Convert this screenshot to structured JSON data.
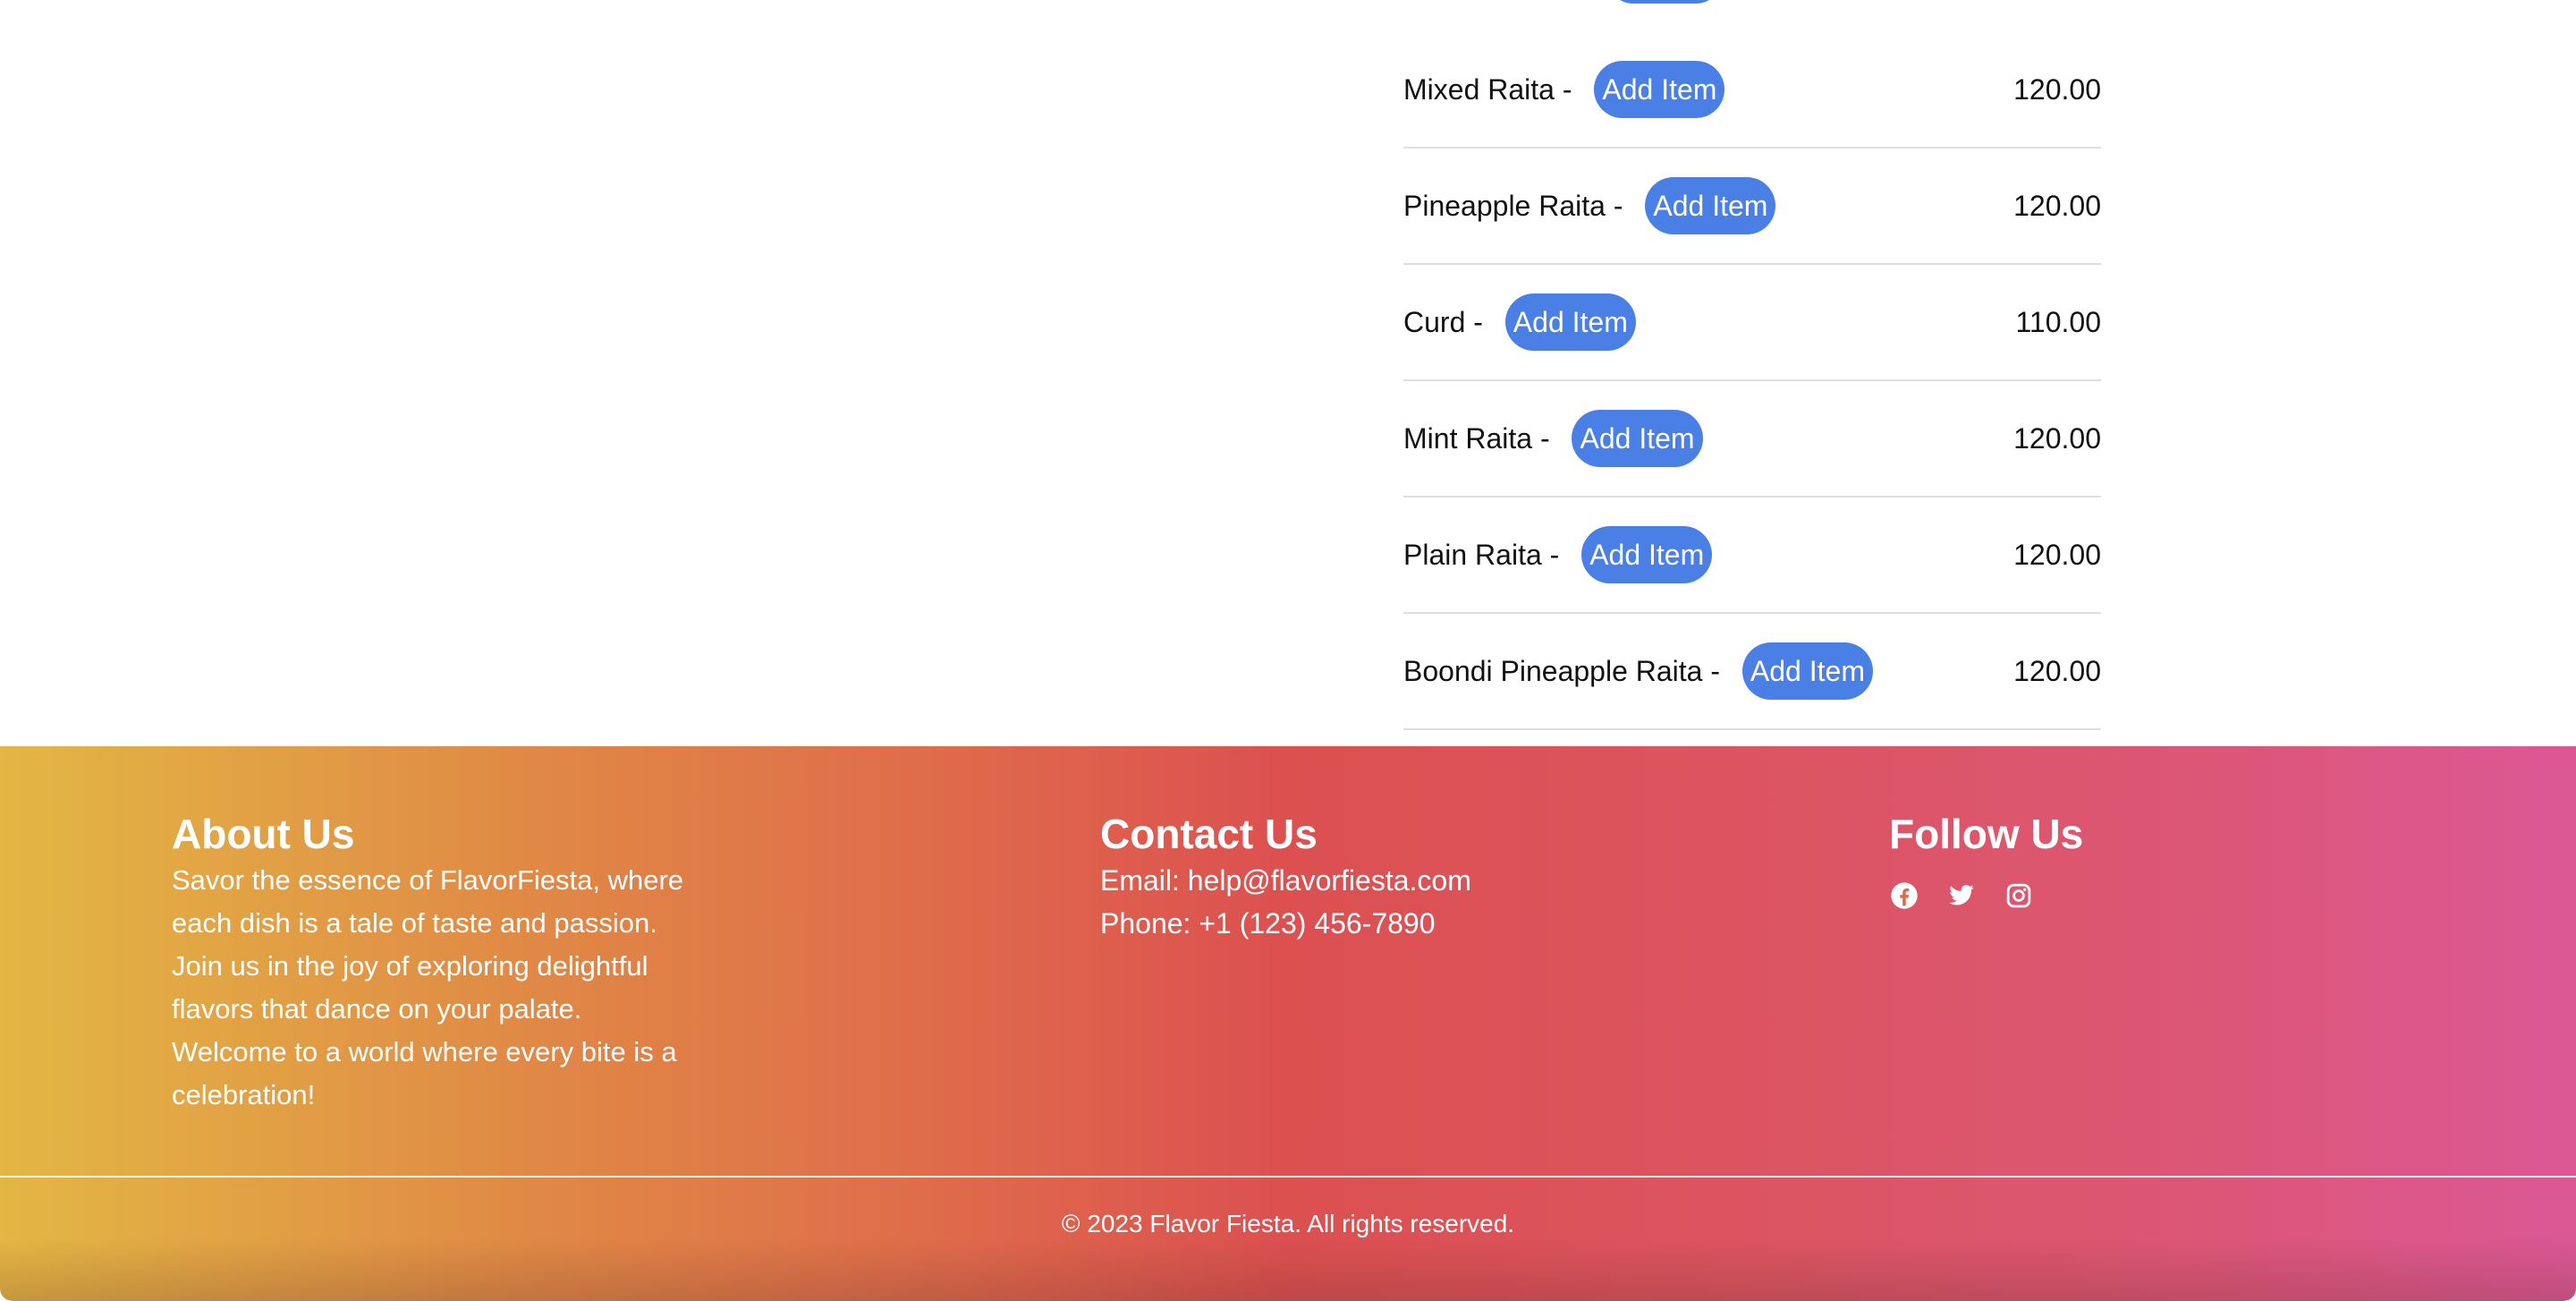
{
  "menu": {
    "items": [
      {
        "name": "Mixed Raita - ",
        "button": "Add Item",
        "price": "120.00"
      },
      {
        "name": "Pineapple Raita - ",
        "button": "Add Item",
        "price": "120.00"
      },
      {
        "name": "Curd - ",
        "button": "Add Item",
        "price": "110.00"
      },
      {
        "name": "Mint Raita - ",
        "button": "Add Item",
        "price": "120.00"
      },
      {
        "name": "Plain Raita - ",
        "button": "Add Item",
        "price": "120.00"
      },
      {
        "name": "Boondi Pineapple Raita - ",
        "button": "Add Item",
        "price": "120.00"
      }
    ]
  },
  "footer": {
    "about": {
      "title": "About Us",
      "text": "Savor the essence of FlavorFiesta, where each dish is a tale of taste and passion. Join us in the joy of exploring delightful flavors that dance on your palate. Welcome to a world where every bite is a celebration!"
    },
    "contact": {
      "title": "Contact Us",
      "email": "Email: help@flavorfiesta.com",
      "phone": "Phone: +1 (123) 456-7890"
    },
    "follow": {
      "title": "Follow Us",
      "icons": [
        "facebook-icon",
        "twitter-icon",
        "instagram-icon"
      ]
    },
    "copyright": "© 2023 Flavor Fiesta. All rights reserved."
  },
  "colors": {
    "button": "#4a7fe6",
    "footer_gradient_start": "#e3b744",
    "footer_gradient_mid": "#dc5050",
    "footer_gradient_end": "#db5895"
  }
}
